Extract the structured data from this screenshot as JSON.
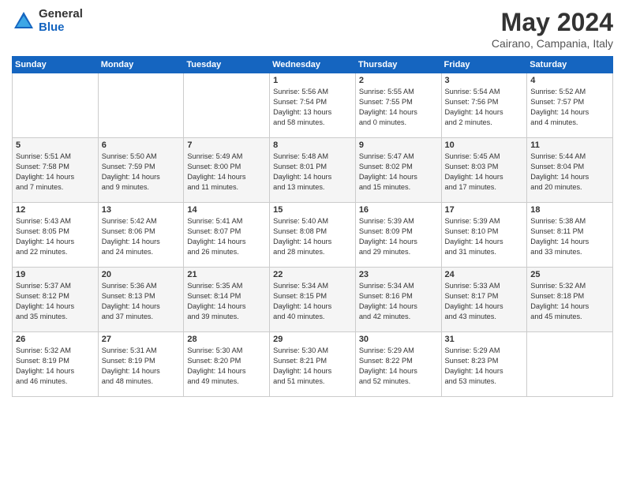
{
  "logo": {
    "general": "General",
    "blue": "Blue"
  },
  "title": "May 2024",
  "location": "Cairano, Campania, Italy",
  "days_of_week": [
    "Sunday",
    "Monday",
    "Tuesday",
    "Wednesday",
    "Thursday",
    "Friday",
    "Saturday"
  ],
  "weeks": [
    [
      {
        "day": "",
        "content": ""
      },
      {
        "day": "",
        "content": ""
      },
      {
        "day": "",
        "content": ""
      },
      {
        "day": "1",
        "content": "Sunrise: 5:56 AM\nSunset: 7:54 PM\nDaylight: 13 hours\nand 58 minutes."
      },
      {
        "day": "2",
        "content": "Sunrise: 5:55 AM\nSunset: 7:55 PM\nDaylight: 14 hours\nand 0 minutes."
      },
      {
        "day": "3",
        "content": "Sunrise: 5:54 AM\nSunset: 7:56 PM\nDaylight: 14 hours\nand 2 minutes."
      },
      {
        "day": "4",
        "content": "Sunrise: 5:52 AM\nSunset: 7:57 PM\nDaylight: 14 hours\nand 4 minutes."
      }
    ],
    [
      {
        "day": "5",
        "content": "Sunrise: 5:51 AM\nSunset: 7:58 PM\nDaylight: 14 hours\nand 7 minutes."
      },
      {
        "day": "6",
        "content": "Sunrise: 5:50 AM\nSunset: 7:59 PM\nDaylight: 14 hours\nand 9 minutes."
      },
      {
        "day": "7",
        "content": "Sunrise: 5:49 AM\nSunset: 8:00 PM\nDaylight: 14 hours\nand 11 minutes."
      },
      {
        "day": "8",
        "content": "Sunrise: 5:48 AM\nSunset: 8:01 PM\nDaylight: 14 hours\nand 13 minutes."
      },
      {
        "day": "9",
        "content": "Sunrise: 5:47 AM\nSunset: 8:02 PM\nDaylight: 14 hours\nand 15 minutes."
      },
      {
        "day": "10",
        "content": "Sunrise: 5:45 AM\nSunset: 8:03 PM\nDaylight: 14 hours\nand 17 minutes."
      },
      {
        "day": "11",
        "content": "Sunrise: 5:44 AM\nSunset: 8:04 PM\nDaylight: 14 hours\nand 20 minutes."
      }
    ],
    [
      {
        "day": "12",
        "content": "Sunrise: 5:43 AM\nSunset: 8:05 PM\nDaylight: 14 hours\nand 22 minutes."
      },
      {
        "day": "13",
        "content": "Sunrise: 5:42 AM\nSunset: 8:06 PM\nDaylight: 14 hours\nand 24 minutes."
      },
      {
        "day": "14",
        "content": "Sunrise: 5:41 AM\nSunset: 8:07 PM\nDaylight: 14 hours\nand 26 minutes."
      },
      {
        "day": "15",
        "content": "Sunrise: 5:40 AM\nSunset: 8:08 PM\nDaylight: 14 hours\nand 28 minutes."
      },
      {
        "day": "16",
        "content": "Sunrise: 5:39 AM\nSunset: 8:09 PM\nDaylight: 14 hours\nand 29 minutes."
      },
      {
        "day": "17",
        "content": "Sunrise: 5:39 AM\nSunset: 8:10 PM\nDaylight: 14 hours\nand 31 minutes."
      },
      {
        "day": "18",
        "content": "Sunrise: 5:38 AM\nSunset: 8:11 PM\nDaylight: 14 hours\nand 33 minutes."
      }
    ],
    [
      {
        "day": "19",
        "content": "Sunrise: 5:37 AM\nSunset: 8:12 PM\nDaylight: 14 hours\nand 35 minutes."
      },
      {
        "day": "20",
        "content": "Sunrise: 5:36 AM\nSunset: 8:13 PM\nDaylight: 14 hours\nand 37 minutes."
      },
      {
        "day": "21",
        "content": "Sunrise: 5:35 AM\nSunset: 8:14 PM\nDaylight: 14 hours\nand 39 minutes."
      },
      {
        "day": "22",
        "content": "Sunrise: 5:34 AM\nSunset: 8:15 PM\nDaylight: 14 hours\nand 40 minutes."
      },
      {
        "day": "23",
        "content": "Sunrise: 5:34 AM\nSunset: 8:16 PM\nDaylight: 14 hours\nand 42 minutes."
      },
      {
        "day": "24",
        "content": "Sunrise: 5:33 AM\nSunset: 8:17 PM\nDaylight: 14 hours\nand 43 minutes."
      },
      {
        "day": "25",
        "content": "Sunrise: 5:32 AM\nSunset: 8:18 PM\nDaylight: 14 hours\nand 45 minutes."
      }
    ],
    [
      {
        "day": "26",
        "content": "Sunrise: 5:32 AM\nSunset: 8:19 PM\nDaylight: 14 hours\nand 46 minutes."
      },
      {
        "day": "27",
        "content": "Sunrise: 5:31 AM\nSunset: 8:19 PM\nDaylight: 14 hours\nand 48 minutes."
      },
      {
        "day": "28",
        "content": "Sunrise: 5:30 AM\nSunset: 8:20 PM\nDaylight: 14 hours\nand 49 minutes."
      },
      {
        "day": "29",
        "content": "Sunrise: 5:30 AM\nSunset: 8:21 PM\nDaylight: 14 hours\nand 51 minutes."
      },
      {
        "day": "30",
        "content": "Sunrise: 5:29 AM\nSunset: 8:22 PM\nDaylight: 14 hours\nand 52 minutes."
      },
      {
        "day": "31",
        "content": "Sunrise: 5:29 AM\nSunset: 8:23 PM\nDaylight: 14 hours\nand 53 minutes."
      },
      {
        "day": "",
        "content": ""
      }
    ]
  ]
}
